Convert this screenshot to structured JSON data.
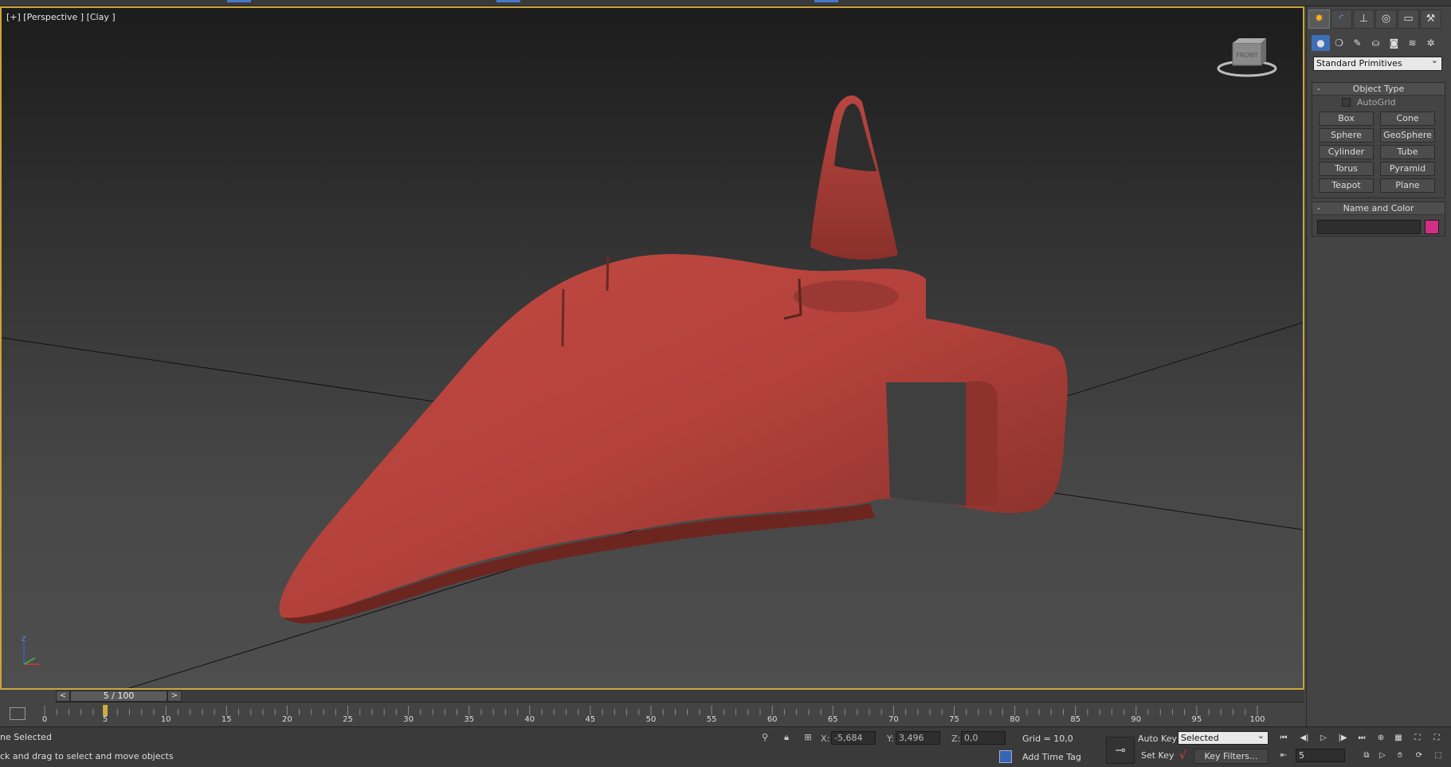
{
  "viewport": {
    "label": "[+] [Perspective ] [Clay ]",
    "viewcube_label": "FRONT",
    "axis_label": "Z"
  },
  "time_slider": {
    "prev": "<",
    "next": ">",
    "position": "5 / 100",
    "current_frame": 5,
    "total_frames": 100
  },
  "track_bar": {
    "labels": [
      "0",
      "5",
      "10",
      "15",
      "20",
      "25",
      "30",
      "35",
      "40",
      "45",
      "50",
      "55",
      "60",
      "65",
      "70",
      "75",
      "80",
      "85",
      "90",
      "95",
      "100"
    ]
  },
  "status": {
    "selection": "ne Selected",
    "prompt": "ck and drag to select and move objects",
    "x_label": "X:",
    "x_value": "-5,684",
    "y_label": "Y:",
    "y_value": "3,496",
    "z_label": "Z:",
    "z_value": "0,0",
    "grid": "Grid = 10,0",
    "add_time_tag": "Add Time Tag",
    "auto_key": "Auto Key",
    "selected_option": "Selected",
    "set_key": "Set Key",
    "key_filters": "Key Filters...",
    "frame_value": "5"
  },
  "command_panel": {
    "tabs": [
      "create",
      "modify",
      "hierarchy",
      "motion",
      "display",
      "utilities"
    ],
    "subcategories": [
      "geometry",
      "shapes",
      "lights",
      "cameras",
      "helpers",
      "space-warps",
      "systems"
    ],
    "dropdown": "Standard Primitives",
    "object_type": {
      "title": "Object Type",
      "collapse": "-",
      "autogrid": "AutoGrid",
      "buttons": [
        "Box",
        "Cone",
        "Sphere",
        "GeoSphere",
        "Cylinder",
        "Tube",
        "Torus",
        "Pyramid",
        "Teapot",
        "Plane"
      ]
    },
    "name_and_color": {
      "title": "Name and Color",
      "collapse": "-",
      "name": "",
      "swatch_color": "#d02f86"
    }
  },
  "colors": {
    "viewport_border": "#c9a53a",
    "model_red": "#b3413b",
    "accent_blue": "#3d6fb8"
  }
}
